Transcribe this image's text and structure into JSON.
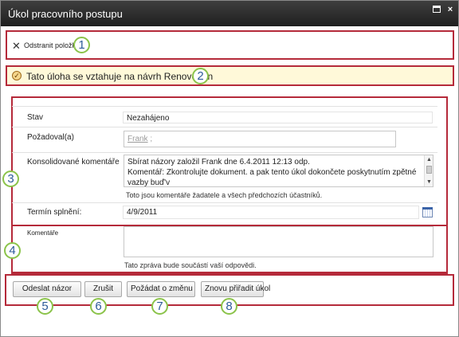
{
  "window": {
    "title": "Úkol pracovního postupu",
    "maximize_icon": "maximize-icon",
    "close_icon": "close-icon",
    "close_glyph": "×"
  },
  "ribbon": {
    "delete_label": "Odstranit položku",
    "delete_glyph": "✕"
  },
  "banner": {
    "text": "Tato úloha se vztahuje na návrh Renovo ton",
    "check_glyph": "✓"
  },
  "form": {
    "status_label": "Stav",
    "status_value": "Nezahájeno",
    "requested_by_label": "Požadoval(a)",
    "requested_by_value": "Frank",
    "requested_by_sep": ";",
    "consolidated_label": "Konsolidované komentáře",
    "consolidated_line1": "Sbírat názory založil Frank dne 6.4.2011 12:13 odp.",
    "consolidated_line2": "Komentář: Zkontrolujte dokument. a pak tento úkol dokončete poskytnutím zpětné vazby buď'v",
    "consolidated_hint": "Toto jsou komentáře žadatele a všech předchozích účastníků.",
    "due_date_label": "Termín splnění:",
    "due_date_value": "4/9/2011",
    "comments_label": "Komentáře",
    "comments_value": "",
    "comments_hint": "Tato zpráva bude součástí vaší odpovědi."
  },
  "buttons": {
    "send_feedback": "Odeslat názor",
    "cancel": "Zrušit",
    "request_change": "Požádat o změnu",
    "reassign": "Znovu přiřadit úkol"
  },
  "callouts": [
    "1",
    "2",
    "3",
    "4",
    "5",
    "6",
    "7",
    "8"
  ],
  "colors": {
    "callout_border": "#8bc34a",
    "callout_text": "#2d5b99",
    "highlight_border": "#b52a3a",
    "banner_bg": "#fff9d9",
    "titlebar": "#2b2b2b"
  }
}
